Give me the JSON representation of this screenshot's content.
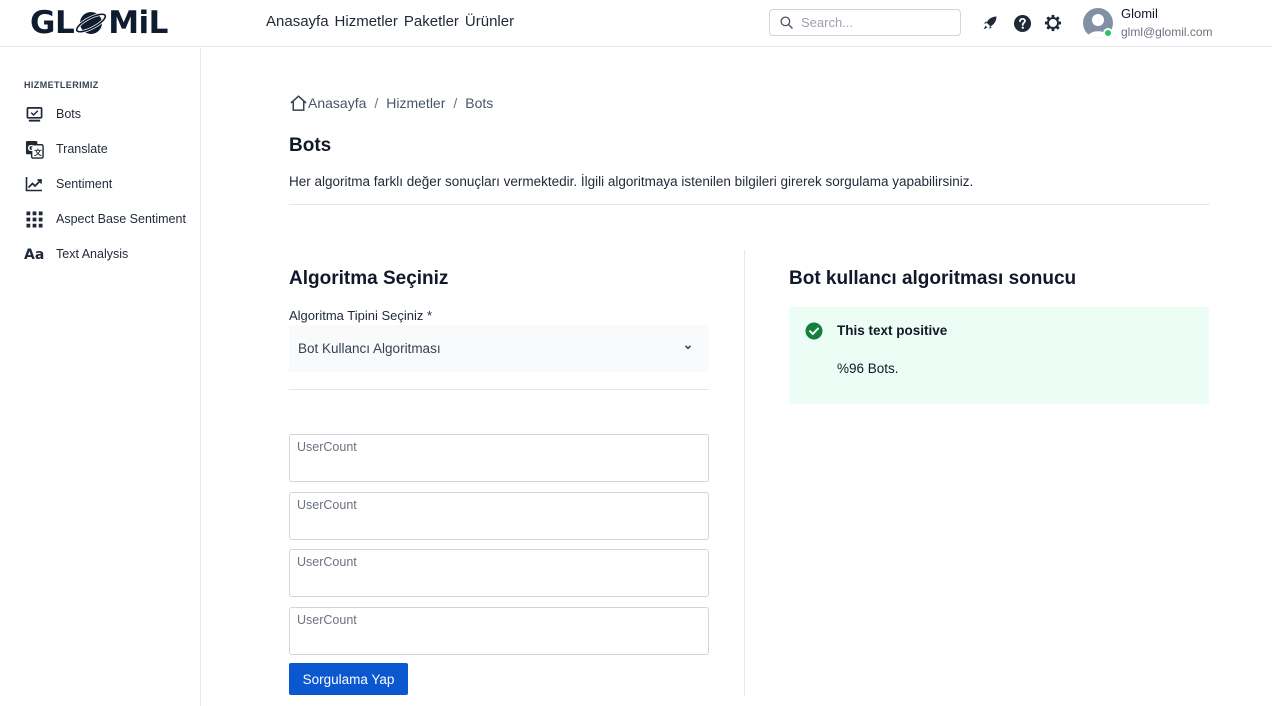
{
  "header": {
    "logo_text": "GL MiL",
    "nav": [
      "Anasayfa",
      "Hizmetler",
      "Paketler",
      "Ürünler"
    ],
    "search_placeholder": "Search...",
    "user": {
      "name": "Glomil",
      "email": "glml@glomil.com"
    }
  },
  "sidebar": {
    "heading": "HIZMETLERIMIZ",
    "items": [
      {
        "label": "Bots",
        "icon": "monitor-icon"
      },
      {
        "label": "Translate",
        "icon": "translate-icon"
      },
      {
        "label": "Sentiment",
        "icon": "trend-chart-icon"
      },
      {
        "label": "Aspect Base Sentiment",
        "icon": "grid-dots-icon"
      },
      {
        "label": "Text Analysis",
        "icon": "text-aa-icon"
      }
    ]
  },
  "breadcrumb": [
    "Anasayfa",
    "Hizmetler",
    "Bots"
  ],
  "page": {
    "title": "Bots",
    "description": "Her algoritma farklı değer sonuçları vermektedir. İlgili algoritmaya istenilen bilgileri girerek sorgulama yapabilirsiniz."
  },
  "form": {
    "title": "Algoritma Seçiniz",
    "select_label": "Algoritma Tipini Seçiniz *",
    "select_value": "Bot Kullancı Algoritması",
    "inputs": [
      {
        "placeholder": "UserCount",
        "value": ""
      },
      {
        "placeholder": "UserCount",
        "value": ""
      },
      {
        "placeholder": "UserCount",
        "value": ""
      },
      {
        "placeholder": "UserCount",
        "value": ""
      }
    ],
    "submit_label": "Sorgulama Yap"
  },
  "result": {
    "title": "Bot kullancı algoritması sonucu",
    "status": "This text positive",
    "text": "%96 Bots."
  },
  "colors": {
    "primary_button": "#0b57d0",
    "success_bg": "#ecfdf5",
    "success_icon": "#15803d",
    "online": "#22c55e"
  }
}
